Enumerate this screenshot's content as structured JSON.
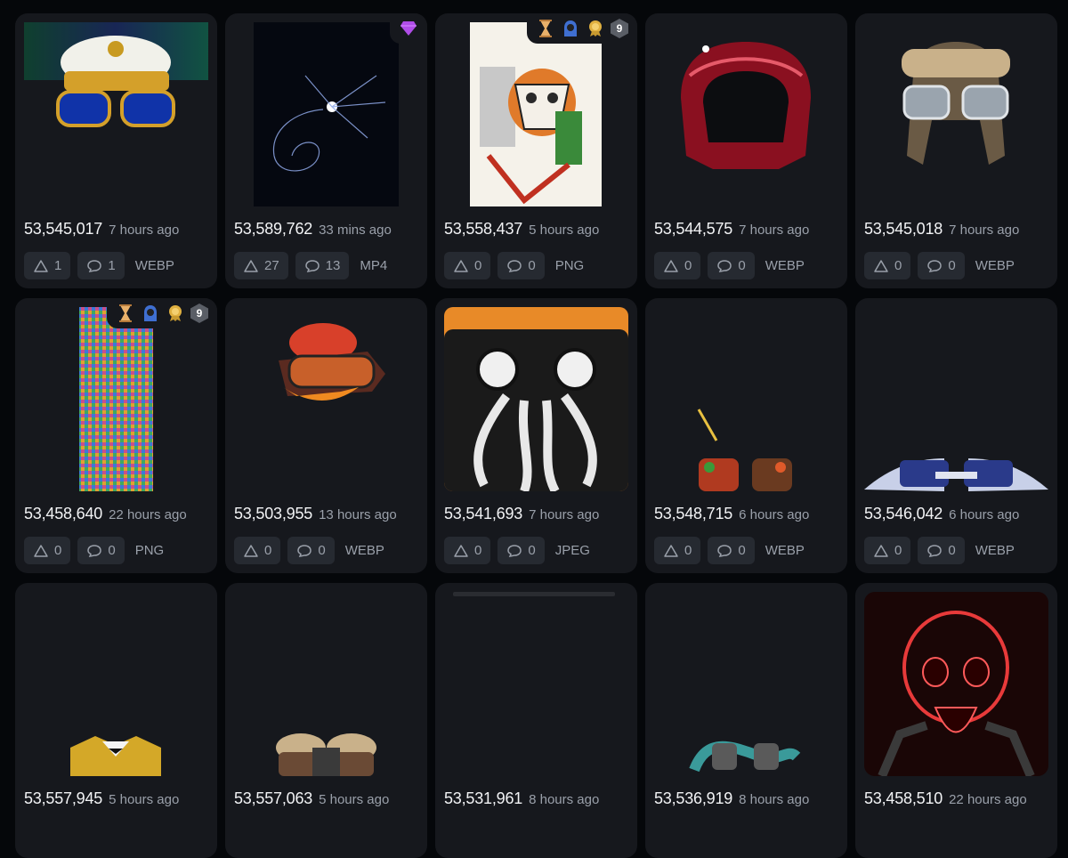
{
  "cards": [
    {
      "number": "53,545,017",
      "time": "7 hours ago",
      "likes": "1",
      "comments": "1",
      "format": "WEBP",
      "art": "captain-hat-sunglasses"
    },
    {
      "number": "53,589,762",
      "time": "33 mins ago",
      "likes": "27",
      "comments": "13",
      "format": "MP4",
      "art": "starry-dragon",
      "badges": [
        "gem-icon"
      ]
    },
    {
      "number": "53,558,437",
      "time": "5 hours ago",
      "likes": "0",
      "comments": "0",
      "format": "PNG",
      "art": "abstract-tiger",
      "badges": [
        "hourglass-icon",
        "hacker-icon",
        "medal-icon"
      ],
      "hex_badge": "9"
    },
    {
      "number": "53,544,575",
      "time": "7 hours ago",
      "likes": "0",
      "comments": "0",
      "format": "WEBP",
      "art": "red-helmet"
    },
    {
      "number": "53,545,018",
      "time": "7 hours ago",
      "likes": "0",
      "comments": "0",
      "format": "WEBP",
      "art": "aviator-fur-hat"
    },
    {
      "number": "53,458,640",
      "time": "22 hours ago",
      "likes": "0",
      "comments": "0",
      "format": "PNG",
      "art": "pixel-mosaic",
      "badges": [
        "hourglass-icon",
        "hacker-icon",
        "medal-icon"
      ],
      "hex_badge": "9"
    },
    {
      "number": "53,503,955",
      "time": "13 hours ago",
      "likes": "0",
      "comments": "0",
      "format": "WEBP",
      "art": "ski-goggles-beak"
    },
    {
      "number": "53,541,693",
      "time": "7 hours ago",
      "likes": "0",
      "comments": "0",
      "format": "JPEG",
      "art": "cthulhu-ink"
    },
    {
      "number": "53,548,715",
      "time": "6 hours ago",
      "likes": "0",
      "comments": "0",
      "format": "WEBP",
      "art": "flower-shoulders"
    },
    {
      "number": "53,546,042",
      "time": "6 hours ago",
      "likes": "0",
      "comments": "0",
      "format": "WEBP",
      "art": "chrome-shoulders"
    },
    {
      "number": "53,557,945",
      "time": "5 hours ago",
      "art": "gold-tuxedo"
    },
    {
      "number": "53,557,063",
      "time": "5 hours ago",
      "art": "fur-collar"
    },
    {
      "number": "53,531,961",
      "time": "8 hours ago",
      "art": "empty"
    },
    {
      "number": "53,536,919",
      "time": "8 hours ago",
      "art": "snake-shoulders"
    },
    {
      "number": "53,458,510",
      "time": "22 hours ago",
      "art": "red-skull"
    }
  ],
  "colors": {
    "page_bg": "#05070a",
    "card_bg": "#16181d",
    "pill_bg": "#262a31",
    "muted_text": "#9aa0aa"
  }
}
